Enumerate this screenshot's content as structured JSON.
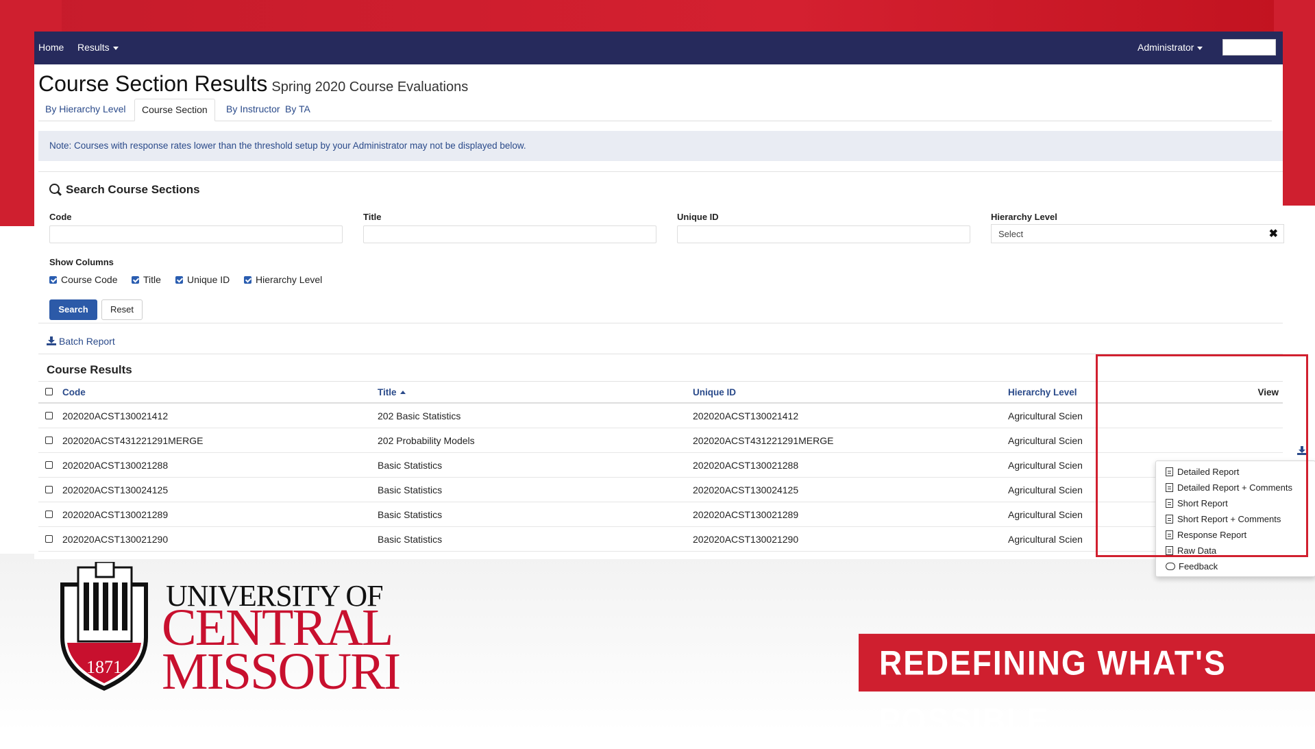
{
  "nav": {
    "home": "Home",
    "results": "Results",
    "user": "Administrator"
  },
  "page": {
    "title": "Course Section Results",
    "subtitle": "Spring 2020 Course Evaluations"
  },
  "tabs": [
    {
      "label": "By Hierarchy Level"
    },
    {
      "label": "Course Section"
    },
    {
      "label": "By Instructor"
    },
    {
      "label": "By TA"
    }
  ],
  "note": "Note: Courses with response rates lower than the threshold setup by your Administrator may not be displayed below.",
  "search": {
    "title": "Search Course Sections",
    "fields": {
      "code": "Code",
      "title": "Title",
      "unique_id": "Unique ID",
      "hierarchy": "Hierarchy Level",
      "hierarchy_value": "Select"
    },
    "show_columns_label": "Show Columns",
    "columns": [
      "Course Code",
      "Title",
      "Unique ID",
      "Hierarchy Level"
    ],
    "search_button": "Search",
    "reset_button": "Reset"
  },
  "batch_report": "Batch Report",
  "results": {
    "title": "Course Results",
    "headers": {
      "code": "Code",
      "title": "Title",
      "unique_id": "Unique ID",
      "hierarchy": "Hierarchy Level",
      "view": "View"
    },
    "rows": [
      {
        "code": "202020ACST130021412",
        "title": "202 Basic Statistics",
        "unique_id": "202020ACST130021412",
        "hierarchy": "Agricultural Scien"
      },
      {
        "code": "202020ACST431221291MERGE",
        "title": "202 Probability Models",
        "unique_id": "202020ACST431221291MERGE",
        "hierarchy": "Agricultural Scien"
      },
      {
        "code": "202020ACST130021288",
        "title": "Basic Statistics",
        "unique_id": "202020ACST130021288",
        "hierarchy": "Agricultural Scien"
      },
      {
        "code": "202020ACST130024125",
        "title": "Basic Statistics",
        "unique_id": "202020ACST130024125",
        "hierarchy": "Agricultural Scien"
      },
      {
        "code": "202020ACST130021289",
        "title": "Basic Statistics",
        "unique_id": "202020ACST130021289",
        "hierarchy": "Agricultural Scien"
      },
      {
        "code": "202020ACST130021290",
        "title": "Basic Statistics",
        "unique_id": "202020ACST130021290",
        "hierarchy": "Agricultural Scien"
      }
    ]
  },
  "view_menu": [
    {
      "label": "Detailed Report",
      "icon": "pdf-icon"
    },
    {
      "label": "Detailed Report + Comments",
      "icon": "pdf-icon"
    },
    {
      "label": "Short Report",
      "icon": "pdf-icon"
    },
    {
      "label": "Short Report + Comments",
      "icon": "pdf-icon"
    },
    {
      "label": "Response Report",
      "icon": "pdf-icon"
    },
    {
      "label": "Raw Data",
      "icon": "excel-icon"
    },
    {
      "label": "Feedback",
      "icon": "comments-icon"
    }
  ],
  "branding": {
    "logo_year": "1871",
    "university_line1": "UNIVERSITY OF",
    "university_line2": "CENTRAL",
    "university_line3": "MISSOURI",
    "tagline": "REDEFINING WHAT'S POSSIBLE",
    "brand_red": "#cf1f2f",
    "nav_navy": "#262a5c"
  }
}
